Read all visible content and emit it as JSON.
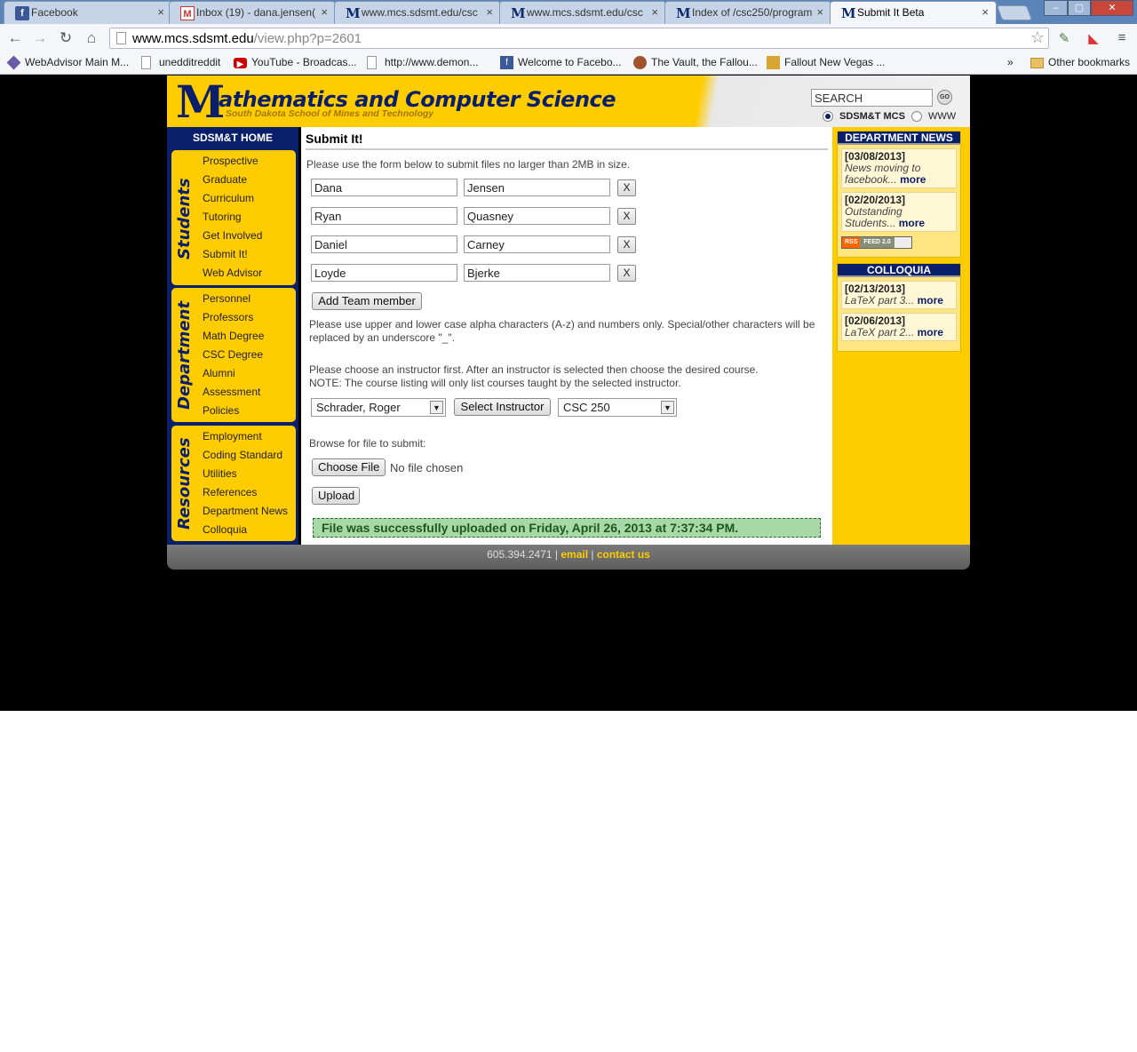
{
  "browser": {
    "tabs": [
      {
        "icon": "facebook-icon",
        "label": "Facebook"
      },
      {
        "icon": "gmail-icon",
        "label": "Inbox (19) - dana.jensen("
      },
      {
        "icon": "sdsmt-m-icon",
        "label": "www.mcs.sdsmt.edu/csc"
      },
      {
        "icon": "sdsmt-m-icon",
        "label": "www.mcs.sdsmt.edu/csc"
      },
      {
        "icon": "sdsmt-m-icon",
        "label": "Index of /csc250/program"
      },
      {
        "icon": "sdsmt-m-icon",
        "label": "Submit It Beta"
      }
    ],
    "url_domain": "www.mcs.sdsmt.edu",
    "url_path": "/view.php?p=2601",
    "bookmarks": [
      {
        "icon": "gem",
        "label": "WebAdvisor Main M..."
      },
      {
        "icon": "doc",
        "label": "unedditreddit"
      },
      {
        "icon": "yt",
        "label": "YouTube - Broadcas..."
      },
      {
        "icon": "doc",
        "label": "http://www.demon..."
      },
      {
        "icon": "fb",
        "label": "Welcome to Facebo..."
      },
      {
        "icon": "vault",
        "label": "The Vault, the Fallou..."
      },
      {
        "icon": "fnv",
        "label": "Fallout New Vegas ..."
      }
    ],
    "bookmarks_overflow": "»",
    "other_bookmarks": "Other bookmarks"
  },
  "header": {
    "logo_letter": "M",
    "logo_title": "athematics and Computer Science",
    "logo_subtitle": "South Dakota School of Mines and Technology",
    "search_value": "SEARCH",
    "search_go": "GO",
    "radio_sdsmt": "SDSM&T MCS",
    "radio_www": "WWW"
  },
  "leftnav": {
    "home": "SDSM&T HOME",
    "sections": [
      {
        "title": "Students",
        "links": [
          "Prospective",
          "Graduate",
          "Curriculum",
          "Tutoring",
          "Get Involved",
          "Submit It!",
          "Web Advisor"
        ]
      },
      {
        "title": "Department",
        "links": [
          "Personnel",
          "Professors",
          "Math Degree",
          "CSC Degree",
          "Alumni",
          "Assessment",
          "Policies"
        ]
      },
      {
        "title": "Resources",
        "links": [
          "Employment",
          "Coding Standard",
          "Utilities",
          "References",
          "Department News",
          "Colloquia"
        ]
      }
    ]
  },
  "content": {
    "title": "Submit It!",
    "intro": "Please use the form below to submit files no larger than 2MB in size.",
    "team": [
      {
        "first": "Dana",
        "last": "Jensen"
      },
      {
        "first": "Ryan",
        "last": "Quasney"
      },
      {
        "first": "Daniel",
        "last": "Carney"
      },
      {
        "first": "Loyde",
        "last": "Bjerke"
      }
    ],
    "remove_label": "X",
    "add_member": "Add Team member",
    "chars_note": "Please use upper and lower case alpha characters (A-z) and numbers only. Special/other characters will be replaced by an underscore \"_\".",
    "instructor_note_1": "Please choose an instructor first. After an instructor is selected then choose the desired course.",
    "instructor_note_2": "NOTE: The course listing will only list courses taught by the selected instructor.",
    "instructor_selected": "Schrader, Roger",
    "select_instructor": "Select Instructor",
    "course_selected": "CSC 250",
    "browse_label": "Browse for file to submit:",
    "choose_file": "Choose File",
    "no_file": "No file chosen",
    "upload": "Upload",
    "success": "File was successfully uploaded on Friday, April 26, 2013 at 7:37:34 PM."
  },
  "right": {
    "news_title": "DEPARTMENT NEWS",
    "news": [
      {
        "date": "[03/08/2013]",
        "text": "News moving to facebook...",
        "more": "more"
      },
      {
        "date": "[02/20/2013]",
        "text": "Outstanding Students...",
        "more": "more"
      }
    ],
    "rss_a": "RSS",
    "rss_b": "FEED 2.0",
    "colloquia_title": "COLLOQUIA",
    "colloquia": [
      {
        "date": "[02/13/2013]",
        "text": "LaTeX part 3...",
        "more": "more"
      },
      {
        "date": "[02/06/2013]",
        "text": "LaTeX part 2...",
        "more": "more"
      }
    ]
  },
  "footer": {
    "phone": "605.394.2471",
    "sep": "|",
    "email": "email",
    "contact": "contact us"
  }
}
